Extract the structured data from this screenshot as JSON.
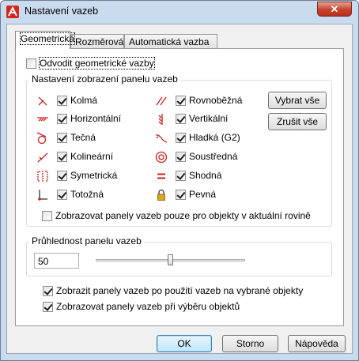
{
  "window": {
    "title": "Nastavení vazeb",
    "close_label": "✕"
  },
  "tabs": [
    {
      "label": "Geometrická",
      "active": true
    },
    {
      "label": "Rozměrová",
      "active": false
    },
    {
      "label": "Automatická vazba",
      "active": false
    }
  ],
  "infer": {
    "label": "Odvodit geometrické vazby",
    "checked": false
  },
  "display_group": {
    "title": "Nastavení zobrazení panelu vazeb",
    "left_items": [
      {
        "label": "Kolmá",
        "icon": "perpendicular-icon",
        "checked": true
      },
      {
        "label": "Horizontální",
        "icon": "horizontal-icon",
        "checked": true
      },
      {
        "label": "Tečná",
        "icon": "tangent-icon",
        "checked": true
      },
      {
        "label": "Kolineární",
        "icon": "collinear-icon",
        "checked": true
      },
      {
        "label": "Symetrická",
        "icon": "symmetric-icon",
        "checked": true
      },
      {
        "label": "Totožná",
        "icon": "coincident-icon",
        "checked": true
      }
    ],
    "right_items": [
      {
        "label": "Rovnoběžná",
        "icon": "parallel-icon",
        "checked": true
      },
      {
        "label": "Vertikální",
        "icon": "vertical-icon",
        "checked": true
      },
      {
        "label": "Hladká (G2)",
        "icon": "smooth-icon",
        "checked": true
      },
      {
        "label": "Soustředná",
        "icon": "concentric-icon",
        "checked": true
      },
      {
        "label": "Shodná",
        "icon": "equal-icon",
        "checked": true
      },
      {
        "label": "Pevná",
        "icon": "lock-icon",
        "checked": true
      }
    ],
    "select_all": "Vybrat vše",
    "clear_all": "Zrušit vše",
    "current_plane": {
      "label": "Zobrazovat panely vazeb pouze pro objekty v aktuální rovině",
      "checked": false
    }
  },
  "transparency": {
    "title": "Průhlednost panelu vazeb",
    "value": "50",
    "slider_fraction": 0.5
  },
  "show_after": {
    "label": "Zobrazit panely vazeb po použití vazeb na vybrané objekty",
    "checked": true
  },
  "show_on_select": {
    "label": "Zobrazovat panely vazeb při výběru objektů",
    "checked": true
  },
  "footer": {
    "ok": "OK",
    "cancel": "Storno",
    "help": "Nápověda"
  },
  "colors": {
    "accent_icon": "#c8201c",
    "titlebar": "#c9dbee",
    "close": "#c7422b"
  }
}
